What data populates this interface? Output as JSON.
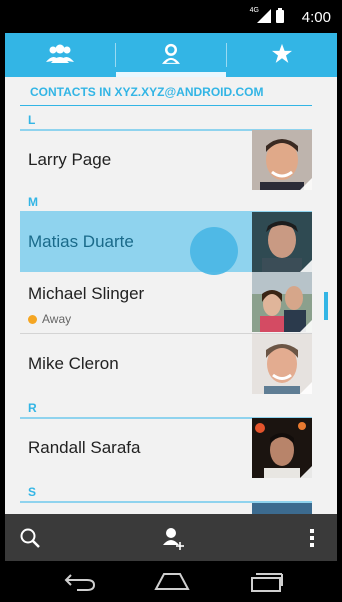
{
  "status_bar": {
    "network": "4G",
    "time": "4:00"
  },
  "tabs": [
    {
      "name": "groups-tab",
      "icon": "groups-icon",
      "active": false
    },
    {
      "name": "contacts-tab",
      "icon": "person-icon",
      "active": true
    },
    {
      "name": "favorites-tab",
      "icon": "star-icon",
      "active": false
    }
  ],
  "account_header": "CONTACTS IN XYZ.XYZ@ANDROID.COM",
  "sections": {
    "L": "L",
    "M": "M",
    "R": "R",
    "S": "S"
  },
  "contacts": [
    {
      "name": "Larry Page",
      "status": ""
    },
    {
      "name": "Matias Duarte",
      "status": ""
    },
    {
      "name": "Michael Slinger",
      "status": "Away"
    },
    {
      "name": "Mike Cleron",
      "status": ""
    },
    {
      "name": "Randall Sarafa",
      "status": ""
    }
  ],
  "action_bar": {
    "search_icon": "search-icon",
    "add_contact_icon": "add-contact-icon",
    "overflow_icon": "overflow-menu-icon"
  },
  "nav_bar": {
    "back_icon": "back-icon",
    "home_icon": "home-icon",
    "recents_icon": "recents-icon"
  },
  "colors": {
    "accent": "#33b5e5",
    "highlight": "#8fd3ee",
    "away": "#f5a623"
  }
}
